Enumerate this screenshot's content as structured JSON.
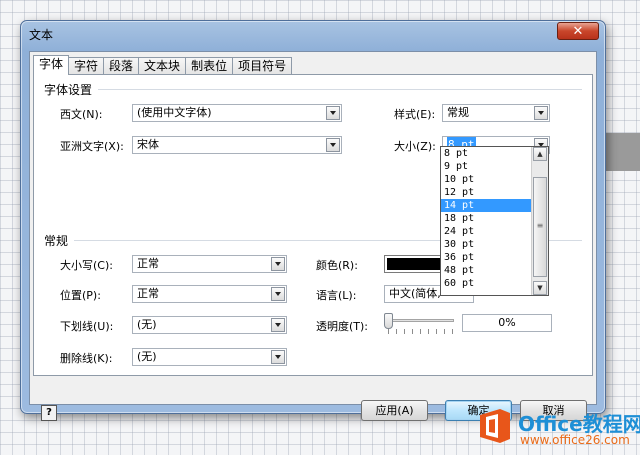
{
  "window": {
    "title": "文本",
    "close_symbol": "✕"
  },
  "tabs": [
    "字体",
    "字符",
    "段落",
    "文本块",
    "制表位",
    "项目符号"
  ],
  "font_settings": {
    "section_label": "字体设置",
    "western_label": "西文(N):",
    "western_value": "(使用中文字体)",
    "asian_label": "亚洲文字(X):",
    "asian_value": "宋体",
    "style_label": "样式(E):",
    "style_value": "常规",
    "size_label": "大小(Z):",
    "size_value": "8 pt",
    "size_options": [
      "8 pt",
      "9 pt",
      "10 pt",
      "12 pt",
      "14 pt",
      "18 pt",
      "24 pt",
      "30 pt",
      "36 pt",
      "48 pt",
      "60 pt"
    ],
    "size_highlighted": "14 pt"
  },
  "general": {
    "section_label": "常规",
    "case_label": "大小写(C):",
    "case_value": "正常",
    "position_label": "位置(P):",
    "position_value": "正常",
    "underline_label": "下划线(U):",
    "underline_value": "(无)",
    "strike_label": "删除线(K):",
    "strike_value": "(无)",
    "color_label": "颜色(R):",
    "color_value": "#000000",
    "language_label": "语言(L):",
    "language_value": "中文(简体,",
    "transparency_label": "透明度(T):",
    "transparency_value": "0%",
    "transparency_level": 0
  },
  "buttons": {
    "help": "?",
    "apply": "应用(A)",
    "ok": "确定",
    "cancel": "取消"
  },
  "watermark": {
    "title": "Office教程网",
    "url": "www.office26.com"
  }
}
